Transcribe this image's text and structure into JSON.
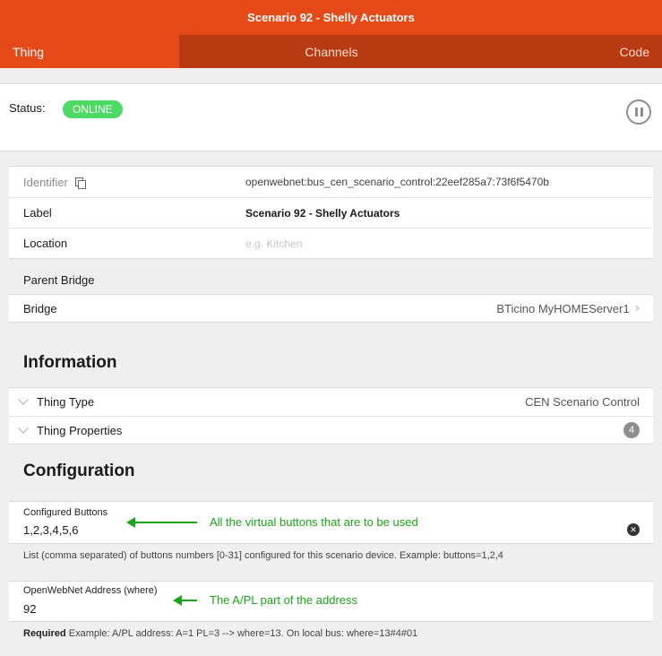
{
  "window": {
    "title": "Scenario 92 - Shelly Actuators"
  },
  "tabs": [
    {
      "label": "Thing"
    },
    {
      "label": "Channels"
    },
    {
      "label": "Code"
    }
  ],
  "status": {
    "label": "Status:",
    "value": "ONLINE",
    "color": "#4cd964"
  },
  "thing": {
    "identifier_label": "Identifier",
    "identifier_value": "openwebnet:bus_cen_scenario_control:22eef285a7:73f6f5470b",
    "label_label": "Label",
    "label_value": "Scenario 92 - Shelly Actuators",
    "location_label": "Location",
    "location_placeholder": "e.g. Kitchen"
  },
  "parent_bridge": {
    "heading": "Parent Bridge",
    "bridge_label": "Bridge",
    "bridge_value": "BTicino MyHOMEServer1"
  },
  "information": {
    "title": "Information",
    "thing_type_label": "Thing Type",
    "thing_type_value": "CEN Scenario Control",
    "thing_properties_label": "Thing Properties",
    "thing_properties_count": "4"
  },
  "configuration": {
    "title": "Configuration",
    "buttons": {
      "label": "Configured Buttons",
      "value": "1,2,3,4,5,6",
      "annotation": "All the virtual buttons that are to be used",
      "help": "List (comma separated) of buttons numbers [0-31] configured for this scenario device. Example: buttons=1,2,4"
    },
    "address": {
      "label": "OpenWebNet Address (where)",
      "value": "92",
      "annotation": "The A/PL part of the address",
      "help_bold": "Required",
      "help": "Example: A/PL address: A=1 PL=3 --> where=13. On local bus: where=13#4#01"
    }
  },
  "colors": {
    "accent": "#e64a19",
    "tab_dark": "#b83a13",
    "annotation": "#1aa31a"
  }
}
